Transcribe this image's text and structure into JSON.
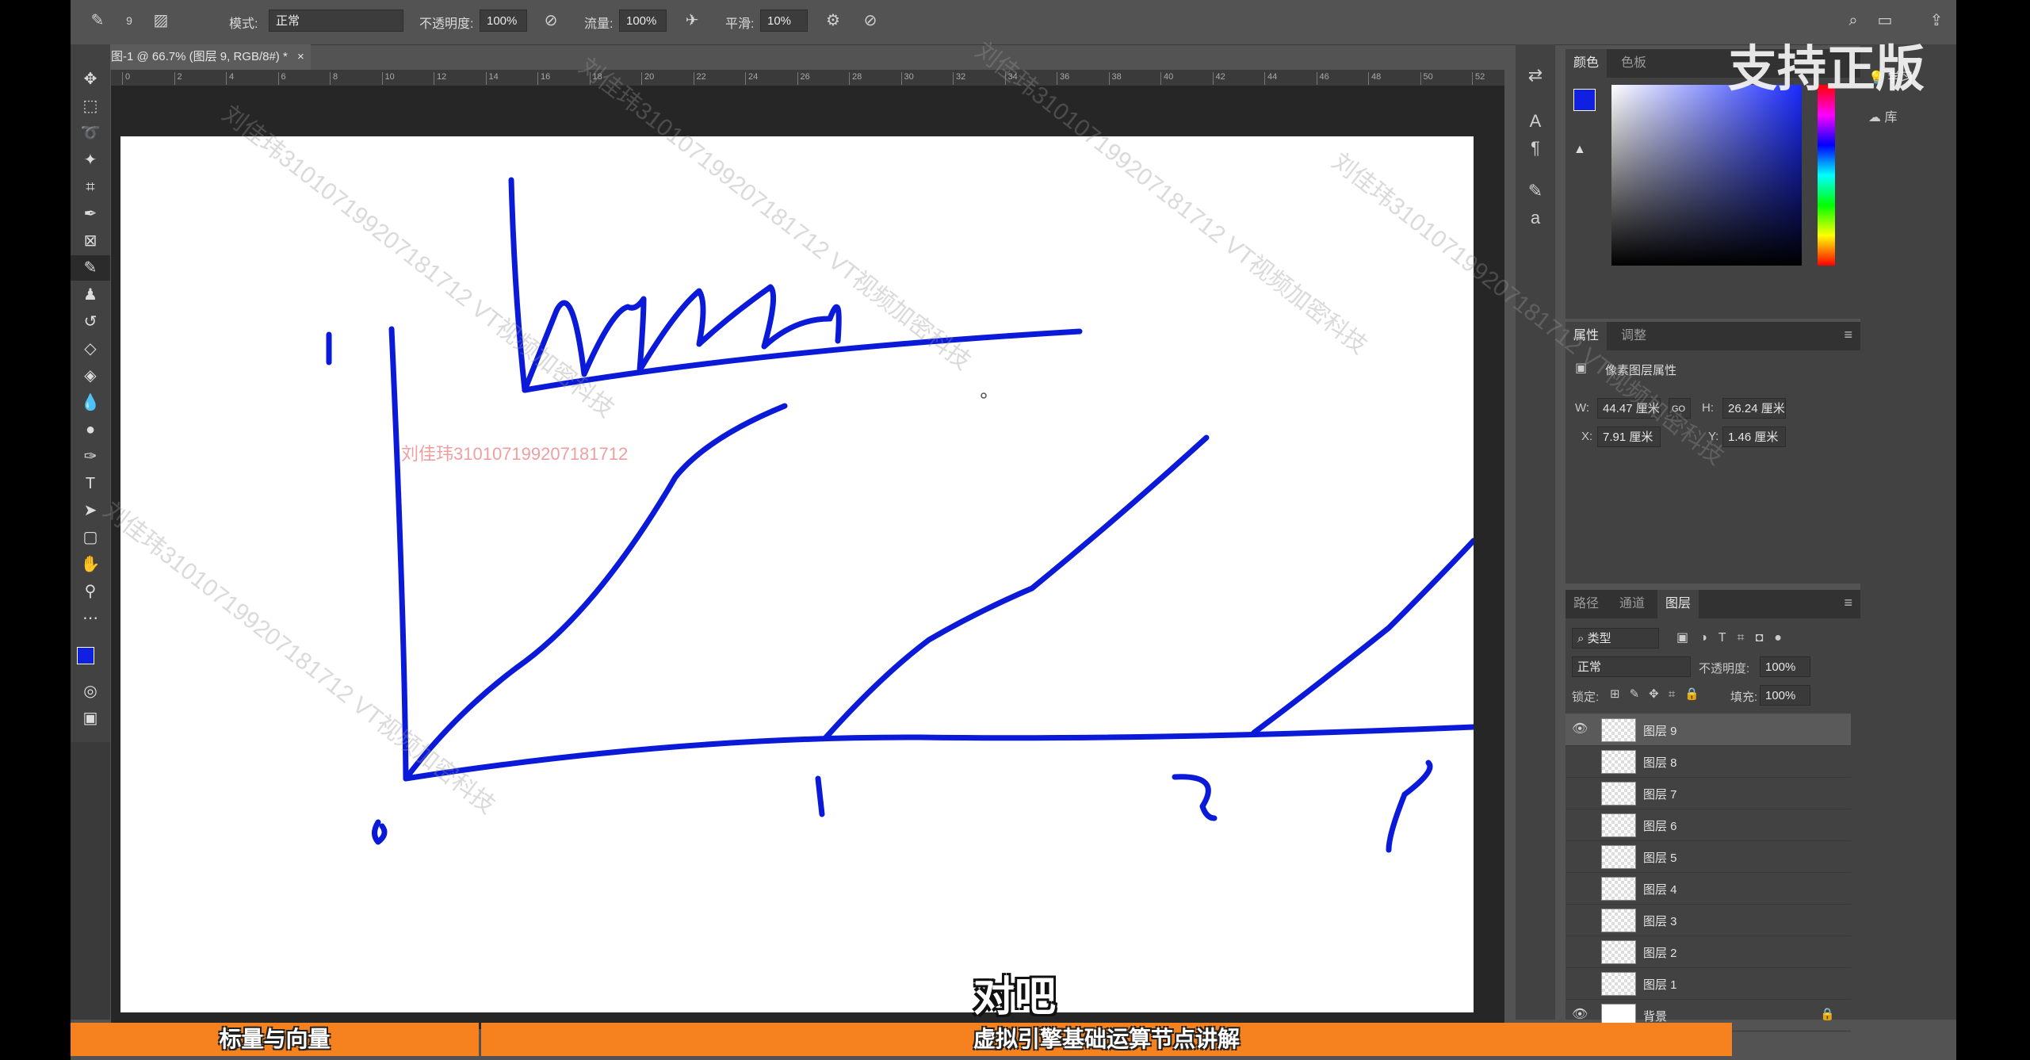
{
  "options_bar": {
    "size_value": "9",
    "mode_label": "模式:",
    "mode_value": "正常",
    "opacity_label": "不透明度:",
    "opacity_value": "100%",
    "flow_label": "流量:",
    "flow_value": "100%",
    "smoothing_label": "平滑:",
    "smoothing_value": "10%"
  },
  "document_tab": {
    "title": "图-1 @ 66.7% (图层 9, RGB/8#) *",
    "close": "×"
  },
  "ruler": {
    "ticks": [
      "0",
      "2",
      "4",
      "6",
      "8",
      "10",
      "12",
      "14",
      "16",
      "18",
      "20",
      "22",
      "24",
      "26",
      "28",
      "30",
      "32",
      "34",
      "36",
      "38",
      "40",
      "42",
      "44",
      "46",
      "48",
      "50",
      "52"
    ]
  },
  "color_panel": {
    "tabs": [
      "颜色",
      "色板"
    ],
    "foreground": "#1020e0",
    "background": "#e03010"
  },
  "side_panel": {
    "learn": "学习",
    "library": "库"
  },
  "properties_panel": {
    "tabs": [
      "属性",
      "调整"
    ],
    "header": "像素图层属性",
    "w_label": "W:",
    "w_value": "44.47 厘米",
    "link_label": "GO",
    "h_label": "H:",
    "h_value": "26.24 厘米",
    "x_label": "X:",
    "x_value": "7.91 厘米",
    "y_label": "Y:",
    "y_value": "1.46 厘米"
  },
  "layers_panel": {
    "tabs": [
      "路径",
      "通道",
      "图层"
    ],
    "filter_value": "类型",
    "blend_value": "正常",
    "opacity_label": "不透明度:",
    "opacity_value": "100%",
    "lock_label": "锁定:",
    "fill_label": "填充:",
    "fill_value": "100%",
    "layers": [
      {
        "name": "图层 9",
        "visible": true,
        "selected": true
      },
      {
        "name": "图层 8",
        "visible": false
      },
      {
        "name": "图层 7",
        "visible": false
      },
      {
        "name": "图层 6",
        "visible": false
      },
      {
        "name": "图层 5",
        "visible": false
      },
      {
        "name": "图层 4",
        "visible": false
      },
      {
        "name": "图层 3",
        "visible": false
      },
      {
        "name": "图层 2",
        "visible": false
      },
      {
        "name": "图层 1",
        "visible": false
      },
      {
        "name": "背景",
        "visible": true,
        "locked": true
      }
    ]
  },
  "canvas_texts": {
    "red_watermark": "刘佳玮3101071992071817​12",
    "support_badge": "支持正版",
    "subtitle": "对吧"
  },
  "watermarks": [
    "刘佳玮310107199207181712 VT视频加密科技",
    "刘佳玮310107199207181712 VT视频加密科技",
    "刘佳玮310107199207181712 VT视频加密科技",
    "刘佳玮310107199207181712 VT视频加密科技",
    "刘佳玮310107199207181712 VT视频加密科技"
  ],
  "bottom_bar": {
    "left_title": "标量与向量",
    "right_title": "虚拟引擎基础运算节点讲解"
  }
}
